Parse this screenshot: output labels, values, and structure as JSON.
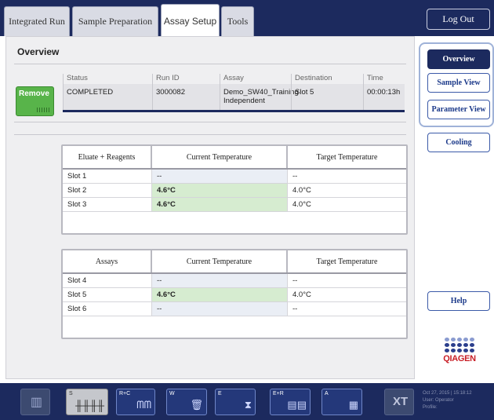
{
  "tabs": [
    {
      "label": "Integrated Run"
    },
    {
      "label": "Sample Preparation"
    },
    {
      "label": "Assay Setup"
    },
    {
      "label": "Tools"
    }
  ],
  "logout_label": "Log Out",
  "overview": {
    "title": "Overview",
    "remove_label": "Remove",
    "columns": [
      "Status",
      "Run ID",
      "Assay",
      "Destination",
      "Time"
    ],
    "run": {
      "status": "COMPLETED",
      "run_id": "3000082",
      "assay_line1": "Demo_SW40_Training",
      "assay_line2": "Independent",
      "destination": "Slot 5",
      "time": "00:00:13h"
    }
  },
  "eluate_table": {
    "headers": [
      "Eluate + Reagents",
      "Current Temperature",
      "Target Temperature"
    ],
    "rows": [
      {
        "slot": "Slot 1",
        "current": "--",
        "target": "--",
        "state": "idle"
      },
      {
        "slot": "Slot 2",
        "current": "4.6°C",
        "target": "4.0°C",
        "state": "active"
      },
      {
        "slot": "Slot 3",
        "current": "4.6°C",
        "target": "4.0°C",
        "state": "active"
      }
    ]
  },
  "assays_table": {
    "headers": [
      "Assays",
      "Current Temperature",
      "Target Temperature"
    ],
    "rows": [
      {
        "slot": "Slot 4",
        "current": "--",
        "target": "--",
        "state": "idle"
      },
      {
        "slot": "Slot 5",
        "current": "4.6°C",
        "target": "4.0°C",
        "state": "active"
      },
      {
        "slot": "Slot 6",
        "current": "--",
        "target": "--",
        "state": "idle"
      }
    ]
  },
  "side": {
    "overview": "Overview",
    "sample_view": "Sample View",
    "parameter_view": "Parameter View",
    "cooling": "Cooling",
    "help": "Help",
    "logo_text": "QIAGEN"
  },
  "toolbar": {
    "slots": [
      {
        "letter": "S",
        "glyph": "╫╫╫╫"
      },
      {
        "letter": "R+C",
        "glyph": "ᗰᗰ"
      },
      {
        "letter": "W",
        "glyph": "🗑"
      },
      {
        "letter": "E",
        "glyph": "⧗"
      },
      {
        "letter": "E+R",
        "glyph": "▤▤"
      },
      {
        "letter": "A",
        "glyph": "▦"
      }
    ],
    "xt_label": "XT",
    "status_line1": "Oct 27, 2015 | 15:18:12",
    "status_line2": "User:     Operator",
    "status_line3": "Profile:"
  },
  "colors": {
    "navy": "#1c2a5e",
    "remove_green": "#58b44a",
    "temp_green": "#d6ecd0",
    "qiagen_red": "#c81d25"
  }
}
